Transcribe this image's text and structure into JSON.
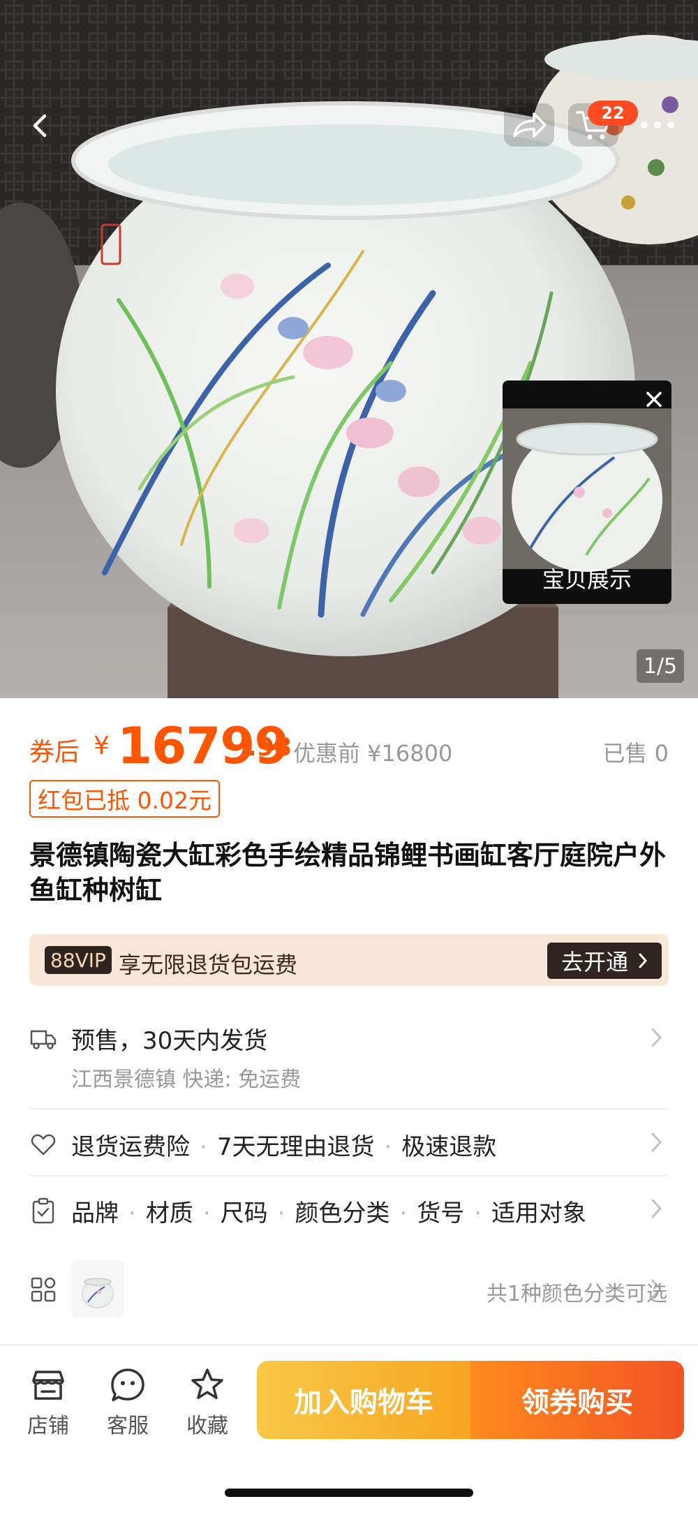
{
  "hero": {
    "cart_count": "22",
    "video_label": "宝贝展示",
    "page_indicator": "1/5"
  },
  "price": {
    "prefix": "券后",
    "currency": "¥",
    "integer": "16799",
    "decimal": ".98",
    "before_label": "优惠前 ¥16800",
    "sold": "已售 0",
    "coupon_tag": "红包已抵 0.02元"
  },
  "title": "景德镇陶瓷大缸彩色手绘精品锦鲤书画缸客厅庭院户外鱼缸种树缸",
  "vip": {
    "badge": "88VIP",
    "text": "享无限退货包运费",
    "button": "去开通"
  },
  "shipping": {
    "main": "预售，30天内发货",
    "sub": "江西景德镇  快递: 免运费"
  },
  "guarantee": {
    "items": [
      "退货运费险",
      "7天无理由退货",
      "极速退款"
    ]
  },
  "params": {
    "items": [
      "品牌",
      "材质",
      "尺码",
      "颜色分类",
      "货号",
      "适用对象"
    ]
  },
  "sku": {
    "text": "共1种颜色分类可选"
  },
  "bottom_bar": {
    "shop": "店铺",
    "service": "客服",
    "favorite": "收藏",
    "add_to_cart": "加入购物车",
    "buy_now": "领券购买"
  },
  "colors": {
    "accent": "#ff5500",
    "cart_gradient": [
      "#f9c847",
      "#f6a623"
    ],
    "buy_gradient": [
      "#ff8a1d",
      "#f25424"
    ]
  }
}
